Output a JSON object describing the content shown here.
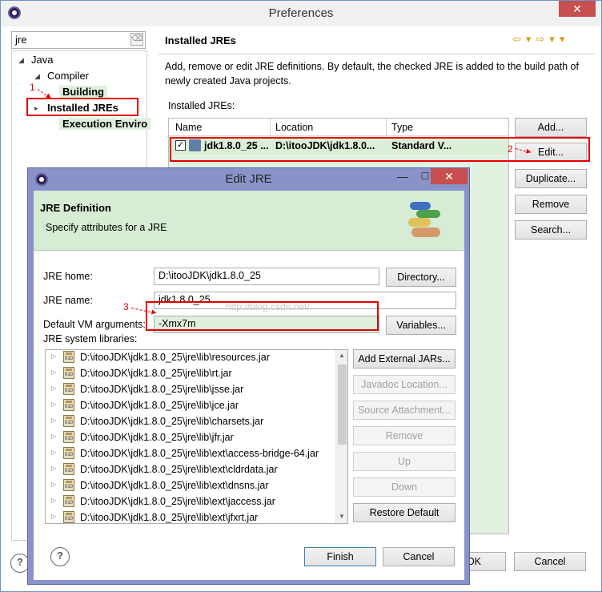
{
  "preferences": {
    "title": "Preferences",
    "filter_value": "jre",
    "tree": [
      {
        "label": "Java",
        "state": "expanded"
      },
      {
        "label": "Compiler",
        "state": "expanded"
      },
      {
        "label": "Building",
        "state": "leaf"
      },
      {
        "label": "Installed JREs",
        "state": "selected"
      },
      {
        "label": "Execution Enviro",
        "state": "leaf"
      }
    ],
    "page_title": "Installed JREs",
    "description": "Add, remove or edit JRE definitions. By default, the checked JRE is added to the build path of newly created Java projects.",
    "installed_label": "Installed JREs:",
    "columns": [
      "Name",
      "Location",
      "Type"
    ],
    "jre_row": {
      "checked": true,
      "name": "jdk1.8.0_25 ...",
      "location": "D:\\itooJDK\\jdk1.8.0...",
      "type": "Standard V..."
    },
    "buttons": {
      "add": "Add...",
      "edit": "Edit...",
      "duplicate": "Duplicate...",
      "remove": "Remove",
      "search": "Search...",
      "ok_partial": "OK",
      "cancel": "Cancel"
    }
  },
  "edit_jre": {
    "title": "Edit JRE",
    "header_title": "JRE Definition",
    "header_subtitle": "Specify attributes for a JRE",
    "jre_home_label": "JRE home:",
    "jre_home_value": "D:\\itooJDK\\jdk1.8.0_25",
    "directory_button": "Directory...",
    "jre_name_label": "JRE name:",
    "jre_name_value": "jdk1.8.0_25",
    "vm_args_label": "Default VM arguments:",
    "vm_args_value": "-Xmx7m",
    "variables_button": "Variables...",
    "libs_label": "JRE system libraries:",
    "libraries": [
      "D:\\itooJDK\\jdk1.8.0_25\\jre\\lib\\resources.jar",
      "D:\\itooJDK\\jdk1.8.0_25\\jre\\lib\\rt.jar",
      "D:\\itooJDK\\jdk1.8.0_25\\jre\\lib\\jsse.jar",
      "D:\\itooJDK\\jdk1.8.0_25\\jre\\lib\\jce.jar",
      "D:\\itooJDK\\jdk1.8.0_25\\jre\\lib\\charsets.jar",
      "D:\\itooJDK\\jdk1.8.0_25\\jre\\lib\\jfr.jar",
      "D:\\itooJDK\\jdk1.8.0_25\\jre\\lib\\ext\\access-bridge-64.jar",
      "D:\\itooJDK\\jdk1.8.0_25\\jre\\lib\\ext\\cldrdata.jar",
      "D:\\itooJDK\\jdk1.8.0_25\\jre\\lib\\ext\\dnsns.jar",
      "D:\\itooJDK\\jdk1.8.0_25\\jre\\lib\\ext\\jaccess.jar",
      "D:\\itooJDK\\jdk1.8.0_25\\jre\\lib\\ext\\jfxrt.jar"
    ],
    "side_buttons": {
      "add_external": "Add External JARs...",
      "javadoc": "Javadoc Location...",
      "source": "Source Attachment...",
      "remove": "Remove",
      "up": "Up",
      "down": "Down",
      "restore": "Restore Default"
    },
    "finish": "Finish",
    "cancel": "Cancel"
  },
  "annotations": [
    "1",
    "2",
    "3"
  ],
  "watermark": "http://blog.csdn.net/",
  "colors": {
    "annotation": "#e60000",
    "highlight_green": "#d6ecd4",
    "dialog_frame": "#8a93c9"
  }
}
